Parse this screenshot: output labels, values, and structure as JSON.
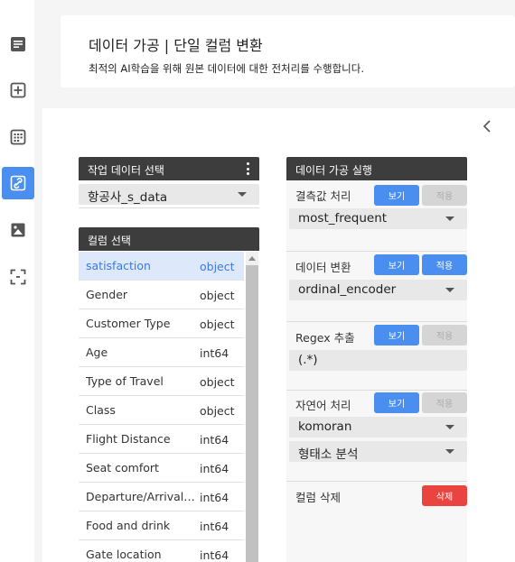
{
  "sidebar": {
    "icons": [
      "list-icon",
      "add-box-icon",
      "grid-icon",
      "link-icon",
      "image-icon",
      "scan-icon"
    ],
    "active_index": 3,
    "accent": "#4a8ff0"
  },
  "header": {
    "title": "데이터 가공 | 단일 컬럼 변환",
    "subtitle": "최적의 AI학습을 위해 원본 데이터에 대한 전처리를 수행합니다."
  },
  "data_select": {
    "title": "작업 데이터 선택",
    "selected": "항공사_s_data"
  },
  "column_select": {
    "title": "컬럼 선택",
    "columns": [
      {
        "name": "satisfaction",
        "type": "object"
      },
      {
        "name": "Gender",
        "type": "object"
      },
      {
        "name": "Customer Type",
        "type": "object"
      },
      {
        "name": "Age",
        "type": "int64"
      },
      {
        "name": "Type of Travel",
        "type": "object"
      },
      {
        "name": "Class",
        "type": "object"
      },
      {
        "name": "Flight Distance",
        "type": "int64"
      },
      {
        "name": "Seat comfort",
        "type": "int64"
      },
      {
        "name": "Departure/Arrival ti…",
        "type": "int64"
      },
      {
        "name": "Food and drink",
        "type": "int64"
      },
      {
        "name": "Gate location",
        "type": "int64"
      }
    ],
    "selected_index": 0
  },
  "processing": {
    "title": "데이터 가공 실행",
    "view_label": "보기",
    "apply_label": "적용",
    "missing": {
      "label": "결측값 처리",
      "value": "most_frequent"
    },
    "transform": {
      "label": "데이터 변환",
      "value": "ordinal_encoder"
    },
    "regex": {
      "label": "Regex 추출",
      "value": "(.*)"
    },
    "nlp": {
      "label": "자연어 처리",
      "value": "komoran",
      "value2": "형태소 분석"
    },
    "delete": {
      "label": "컬럼 삭제",
      "button": "삭제"
    }
  },
  "colors": {
    "blue": "#4a8ff0",
    "red": "#e94440",
    "dark_header": "#3d3d3d",
    "selected_row": "#dde9fa"
  }
}
